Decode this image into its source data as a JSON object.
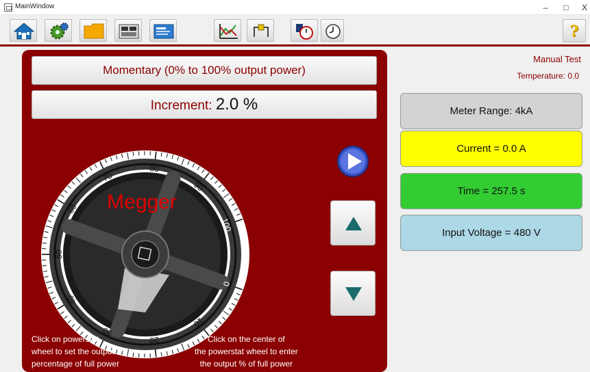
{
  "window": {
    "title": "MainWindow",
    "minimize": "–",
    "maximize": "□",
    "close": "X"
  },
  "toolbar": {
    "icons": [
      "home-icon",
      "settings-gear-icon",
      "folder-icon",
      "multimeter-icon",
      "test-card-icon",
      "graph-icon",
      "clamp-icon",
      "stopwatch-icon",
      "timer-icon"
    ],
    "help": "?"
  },
  "panel": {
    "mode_button": "Momentary  (0% to 100% output power)",
    "increment_label": "Increment: ",
    "increment_value": "2.0 %",
    "dial": {
      "brand": "Megger",
      "ticks": [
        "0",
        "10",
        "20",
        "30",
        "40",
        "50",
        "60",
        "70",
        "80",
        "90",
        "100"
      ]
    },
    "hint_left": [
      "Click on powerstat",
      "wheel to set the output",
      "percentage of  full power"
    ],
    "hint_right": [
      "Click on the center of",
      "the powerstat wheel to enter",
      "the output %  of full power"
    ]
  },
  "status": {
    "mode": "Manual Test",
    "temperature": "Temperature: 0.0",
    "meter_range": "Meter Range: 4kA",
    "current": "Current  = 0.0 A",
    "time": "Time = 257.5 s",
    "input_voltage": "Input Voltage = 480 V"
  },
  "colors": {
    "accent": "#8b0000",
    "current_bg": "#ffff00",
    "time_bg": "#33cc33",
    "voltage_bg": "#add8e6",
    "meter_bg": "#d3d3d3"
  }
}
